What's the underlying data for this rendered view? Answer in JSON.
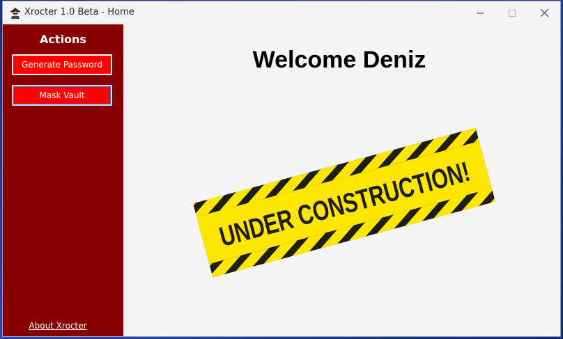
{
  "window": {
    "title": "Xrocter 1.0 Beta - Home"
  },
  "sidebar": {
    "title": "Actions",
    "buttons": [
      {
        "label": "Generate Password"
      },
      {
        "label": "Mask Vault"
      }
    ],
    "about_link": "About Xrocter"
  },
  "main": {
    "welcome": "Welcome Deniz",
    "banner_text": "UNDER CONSTRUCTION!"
  },
  "colors": {
    "sidebar_bg": "#880000",
    "button_bg": "#ff0000",
    "banner_yellow": "#ffe600",
    "banner_black": "#1e1e14"
  }
}
